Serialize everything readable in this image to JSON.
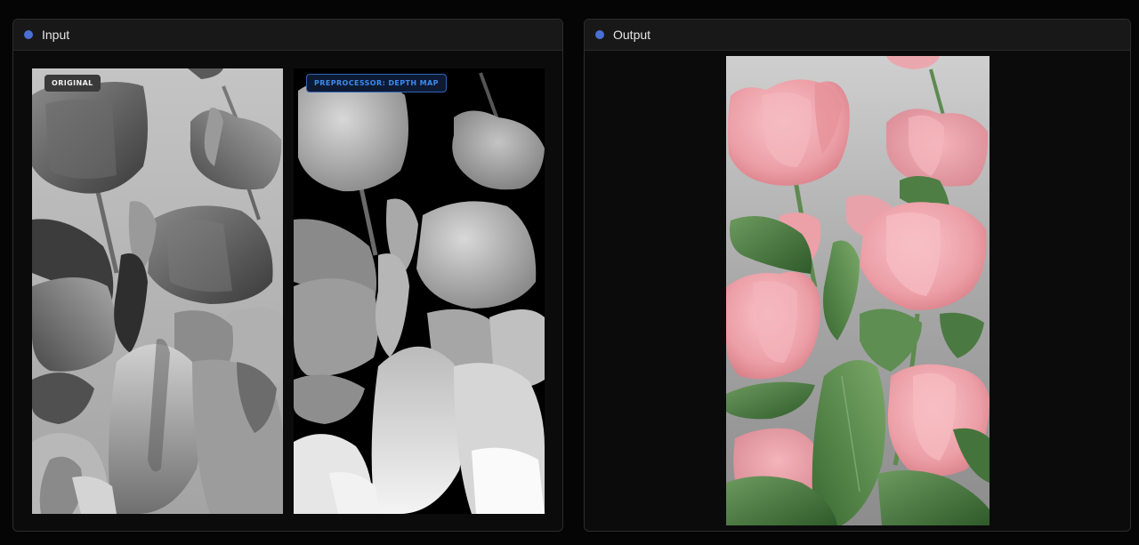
{
  "panels": {
    "input": {
      "title": "Input",
      "dot_color": "#4a6fd4"
    },
    "output": {
      "title": "Output",
      "dot_color": "#4a6fd4"
    }
  },
  "input_images": {
    "original_badge": "ORIGINAL",
    "depth_badge": "PREPROCESSOR: DEPTH MAP"
  },
  "colors": {
    "accent_blue": "#3d8bef",
    "panel_bg": "#0b0b0b",
    "header_bg": "#181818"
  }
}
